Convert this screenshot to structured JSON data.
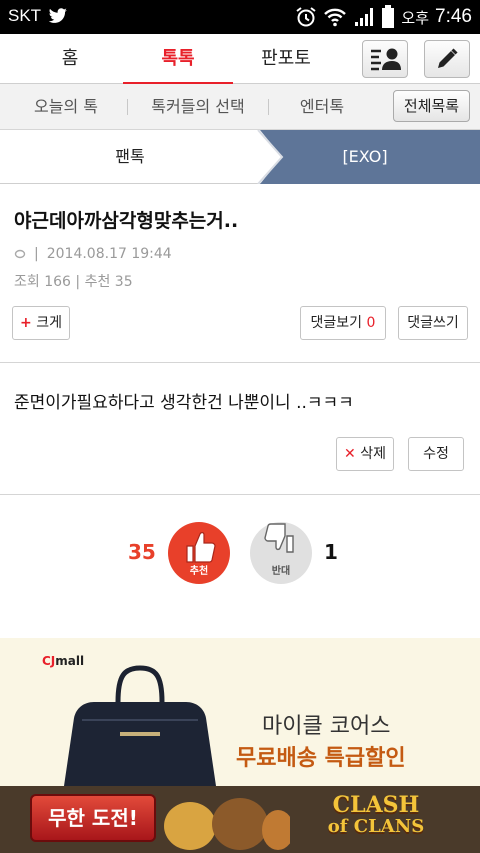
{
  "status_bar": {
    "carrier": "SKT",
    "ampm": "오후",
    "time": "7:46"
  },
  "main_tabs": [
    {
      "label": "홈"
    },
    {
      "label": "톡톡",
      "active": true
    },
    {
      "label": "판포토"
    }
  ],
  "header_icons": [
    "profile-list-icon",
    "pencil-icon"
  ],
  "sub_nav": {
    "items": [
      "오늘의 톡",
      "톡커들의 선택",
      "엔터톡"
    ],
    "all_button": "전체목록"
  },
  "breadcrumb": {
    "board": "팬톡",
    "category": "[EXO]"
  },
  "post": {
    "title": "야근데아까삼각형맞추는거..",
    "date": "2014.08.17 19:44",
    "views_label": "조회",
    "views": "166",
    "recommend_label": "추천",
    "recommend": "35",
    "zoom_button": "크게",
    "view_comments_label": "댓글보기",
    "comment_count": "0",
    "write_comment_label": "댓글쓰기"
  },
  "comment": {
    "text": "준면이가필요하다고 생각한건 나뿐이니 ..ㅋㅋㅋ",
    "delete_label": "삭제",
    "edit_label": "수정"
  },
  "vote": {
    "up_count": "35",
    "up_label": "추천",
    "down_label": "반대",
    "down_count": "1",
    "up_color": "#e8402a",
    "down_color": "#e0e0e0"
  },
  "ad_banner": {
    "brand_prefix": "CJ",
    "brand_suffix": "mall",
    "line1": "마이클 코어스",
    "line2": "무료배송 특급할인"
  },
  "game_banner": {
    "cta": "무한 도전!",
    "game_title_1": "CLASH",
    "game_title_2": "of CLANS"
  }
}
